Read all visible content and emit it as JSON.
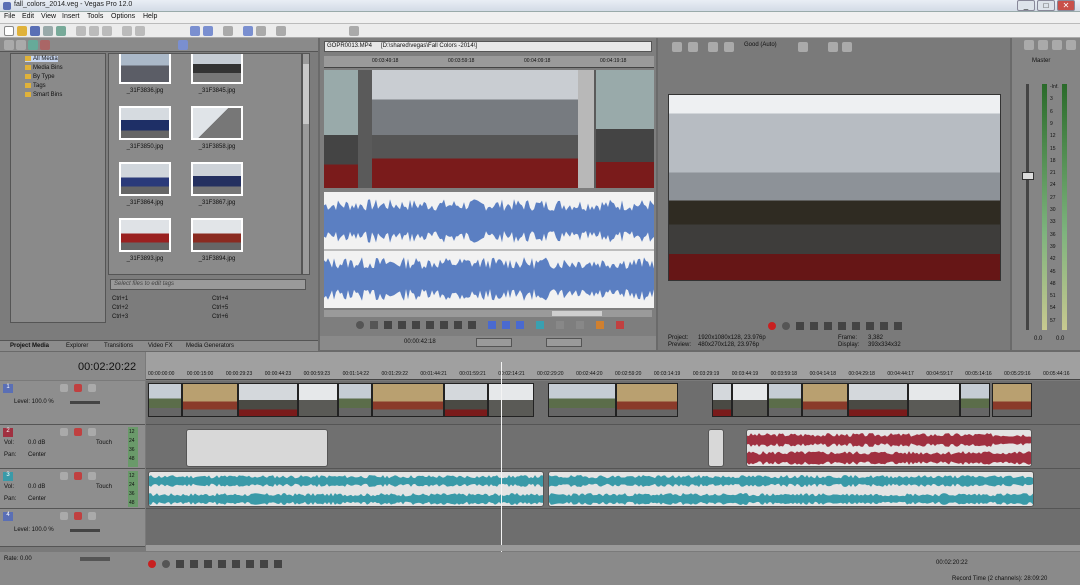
{
  "window": {
    "title": "fall_colors_2014.veg - Vegas Pro 12.0",
    "controls": [
      "_",
      "□",
      "✕"
    ]
  },
  "menu": [
    "File",
    "Edit",
    "View",
    "Insert",
    "Tools",
    "Options",
    "Help"
  ],
  "explorer": {
    "tree": [
      "All Media",
      "Media Bins",
      "By Type",
      "Tags",
      "Smart Bins"
    ],
    "thumbs": [
      "_31F3836.jpg",
      "_31F3845.jpg",
      "_31F3850.jpg",
      "_31F3858.jpg",
      "_31F3864.jpg",
      "_31F3867.jpg",
      "_31F3893.jpg",
      "_31F3894.jpg"
    ],
    "tag_placeholder": "Select files to edit tags",
    "shortcuts": [
      "Ctrl+1",
      "Ctrl+4",
      "Ctrl+2",
      "Ctrl+5",
      "Ctrl+3",
      "Ctrl+6"
    ],
    "tabs": [
      "Project Media",
      "Explorer",
      "Transitions",
      "Video FX",
      "Media Generators"
    ]
  },
  "trimmer": {
    "file": "GOPR0013.MP4",
    "path": "[D:\\shared\\vegas\\Fall Colors -2014\\]",
    "ruler": [
      "00:03:49:18",
      "00:03:59:18",
      "00:04:09:18",
      "00:04:19:18"
    ],
    "timecode": "00:00:42:18"
  },
  "preview": {
    "quality": "Good (Auto)",
    "project_label": "Project:",
    "project_value": "1920x1080x128, 23.976p",
    "preview_label": "Preview:",
    "preview_value": "480x270x128, 23.976p",
    "frame_label": "Frame:",
    "frame_value": "3,382",
    "display_label": "Display:",
    "display_value": "393x334x32"
  },
  "master": {
    "label": "Master",
    "scale": [
      "-Inf.",
      "3",
      "6",
      "9",
      "12",
      "15",
      "18",
      "21",
      "24",
      "27",
      "30",
      "33",
      "36",
      "39",
      "42",
      "45",
      "48",
      "51",
      "54",
      "57"
    ],
    "bottom": [
      "0.0",
      "0.0"
    ]
  },
  "timeline": {
    "timecode": "00:02:20:22",
    "ruler": [
      "00:00:00:00",
      "00:00:15:00",
      "00:00:29:23",
      "00:00:44:23",
      "00:00:59:23",
      "00:01:14:22",
      "00:01:29:22",
      "00:01:44:21",
      "00:01:59:21",
      "00:02:14:21",
      "00:02:29:20",
      "00:02:44:20",
      "00:02:59:20",
      "00:03:14:19",
      "00:03:29:19",
      "00:03:44:19",
      "00:03:59:18",
      "00:04:14:18",
      "00:04:29:18",
      "00:04:44:17",
      "00:04:59:17",
      "00:05:14:16",
      "00:05:29:16",
      "00:05:44:16"
    ],
    "tracks": [
      {
        "num": "1",
        "color": "#5a6fb5",
        "type": "video",
        "level": "Level: 100.0 %"
      },
      {
        "num": "2",
        "color": "#a03040",
        "type": "audio",
        "vol": "Vol:",
        "vol_value": "0.0 dB",
        "pan": "Pan:",
        "pan_value": "Center",
        "mode": "Touch"
      },
      {
        "num": "3",
        "color": "#3a9aa8",
        "type": "audio",
        "vol": "Vol:",
        "vol_value": "0.0 dB",
        "pan": "Pan:",
        "pan_value": "Center",
        "mode": "Touch"
      },
      {
        "num": "4",
        "color": "#5a6fb5",
        "type": "video",
        "level": "Level: 100.0 %"
      }
    ],
    "meter_nums": [
      "12",
      "24",
      "36",
      "48"
    ],
    "rate": "Rate: 0.00",
    "end_timecode": "00:02:20:22",
    "record_time": "Record Time (2 channels): 28:09:20"
  },
  "colors": {
    "video_track": "#5a6fb5",
    "audio_red": "#a03040",
    "audio_teal": "#3a9aa8",
    "waveform_blue": "#5b7fc2"
  }
}
